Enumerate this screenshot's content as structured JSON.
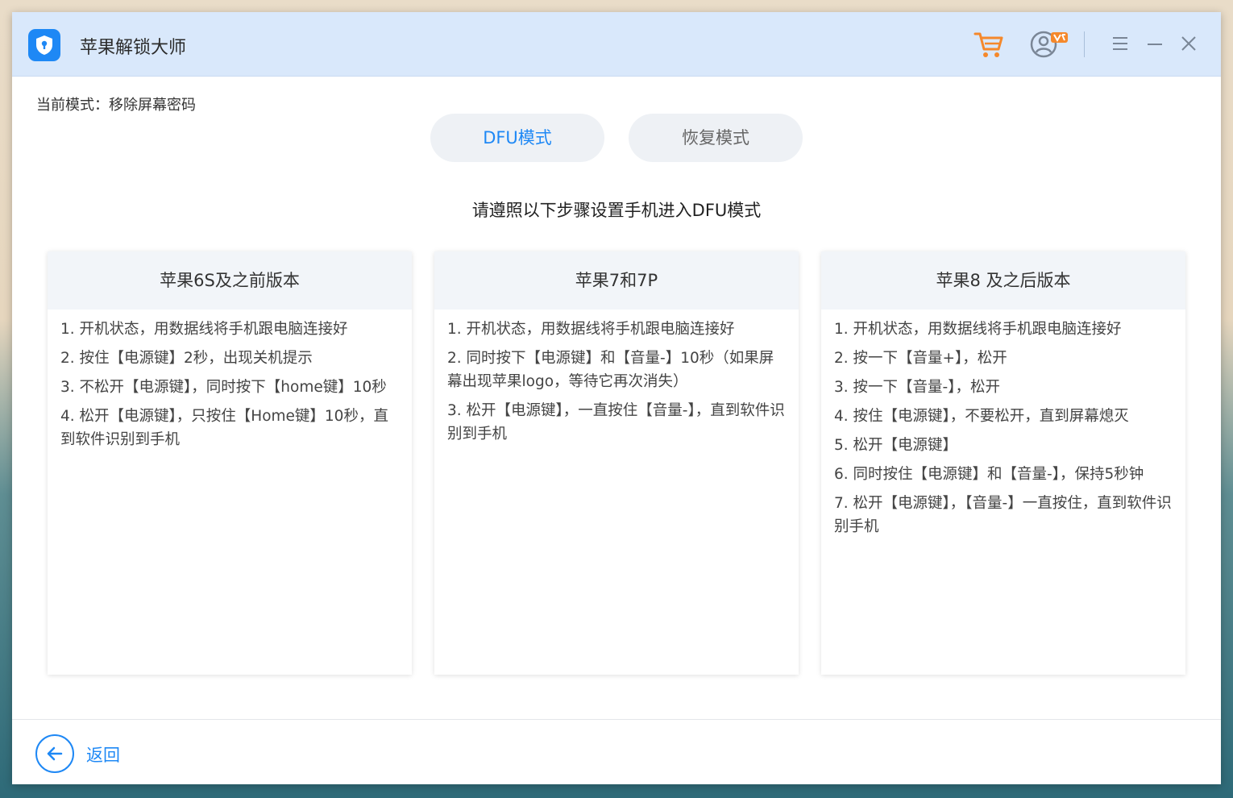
{
  "app": {
    "title": "苹果解锁大师"
  },
  "header": {
    "icons": [
      "cart-icon",
      "user-vip-icon",
      "menu-icon",
      "minimize-icon",
      "close-icon"
    ],
    "accent_color": "#1e88f5",
    "cart_color": "#f5882b"
  },
  "mode": {
    "label": "当前模式：移除屏幕密码"
  },
  "tabs": [
    {
      "label": "DFU模式",
      "active": true
    },
    {
      "label": "恢复模式",
      "active": false
    }
  ],
  "instruction": "请遵照以下步骤设置手机进入DFU模式",
  "cards": [
    {
      "title": "苹果6S及之前版本",
      "steps": [
        "1. 开机状态，用数据线将手机跟电脑连接好",
        "2. 按住【电源键】2秒，出现关机提示",
        "3. 不松开【电源键】，同时按下【home键】10秒",
        "4. 松开【电源键】，只按住【Home键】10秒，直到软件识别到手机"
      ]
    },
    {
      "title": "苹果7和7P",
      "steps": [
        "1. 开机状态，用数据线将手机跟电脑连接好",
        "2. 同时按下【电源键】和【音量-】10秒（如果屏幕出现苹果logo，等待它再次消失）",
        "3. 松开【电源键】，一直按住【音量-】，直到软件识别到手机"
      ]
    },
    {
      "title": "苹果8 及之后版本",
      "steps": [
        "1. 开机状态，用数据线将手机跟电脑连接好",
        "2. 按一下【音量+】，松开",
        "3. 按一下【音量-】，松开",
        "4. 按住【电源键】，不要松开，直到屏幕熄灭",
        "5. 松开【电源键】",
        "6. 同时按住【电源键】和【音量-】，保持5秒钟",
        "7. 松开【电源键】，【音量-】一直按住，直到软件识别手机"
      ]
    }
  ],
  "footer": {
    "back_label": "返回"
  }
}
